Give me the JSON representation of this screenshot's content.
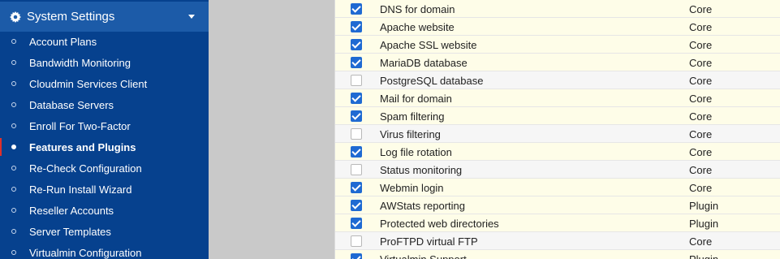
{
  "sidebar": {
    "section_title": "System Settings",
    "items": [
      {
        "label": "Account Plans",
        "active": false
      },
      {
        "label": "Bandwidth Monitoring",
        "active": false
      },
      {
        "label": "Cloudmin Services Client",
        "active": false
      },
      {
        "label": "Database Servers",
        "active": false
      },
      {
        "label": "Enroll For Two-Factor",
        "active": false
      },
      {
        "label": "Features and Plugins",
        "active": true
      },
      {
        "label": "Re-Check Configuration",
        "active": false
      },
      {
        "label": "Re-Run Install Wizard",
        "active": false
      },
      {
        "label": "Reseller Accounts",
        "active": false
      },
      {
        "label": "Server Templates",
        "active": false
      },
      {
        "label": "Virtualmin Configuration",
        "active": false
      }
    ]
  },
  "features": [
    {
      "name": "DNS for domain",
      "source": "Core",
      "enabled": true
    },
    {
      "name": "Apache website",
      "source": "Core",
      "enabled": true
    },
    {
      "name": "Apache SSL website",
      "source": "Core",
      "enabled": true
    },
    {
      "name": "MariaDB database",
      "source": "Core",
      "enabled": true
    },
    {
      "name": "PostgreSQL database",
      "source": "Core",
      "enabled": false
    },
    {
      "name": "Mail for domain",
      "source": "Core",
      "enabled": true
    },
    {
      "name": "Spam filtering",
      "source": "Core",
      "enabled": true
    },
    {
      "name": "Virus filtering",
      "source": "Core",
      "enabled": false
    },
    {
      "name": "Log file rotation",
      "source": "Core",
      "enabled": true
    },
    {
      "name": "Status monitoring",
      "source": "Core",
      "enabled": false
    },
    {
      "name": "Webmin login",
      "source": "Core",
      "enabled": true
    },
    {
      "name": "AWStats reporting",
      "source": "Plugin",
      "enabled": true
    },
    {
      "name": "Protected web directories",
      "source": "Plugin",
      "enabled": true
    },
    {
      "name": "ProFTPD virtual FTP",
      "source": "Core",
      "enabled": false
    },
    {
      "name": "Virtualmin Support",
      "source": "Plugin",
      "enabled": true
    }
  ],
  "colors": {
    "sidebar_bg": "#06418e",
    "section_header_bg": "#1c5ba8",
    "active_marker": "#e0302b",
    "checkbox_checked": "#1f6ad2",
    "row_enabled_bg": "#fefde8",
    "row_disabled_bg": "#f6f6f6"
  }
}
